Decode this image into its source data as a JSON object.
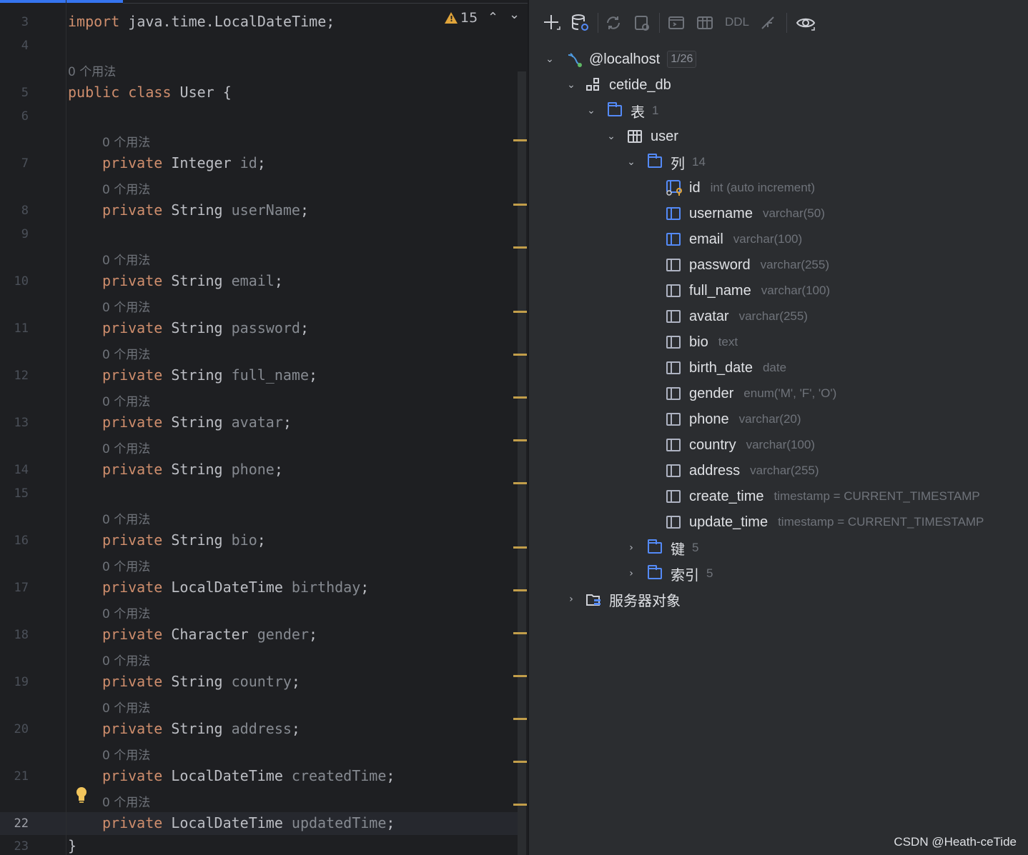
{
  "editor": {
    "warning_count": "15",
    "usage_hint": "0 个用法",
    "lines": [
      {
        "no": "3",
        "parts": [
          [
            "kw",
            "import"
          ],
          [
            "ty",
            " java.time.LocalDateTime;"
          ]
        ]
      },
      {
        "no": "4",
        "parts": []
      },
      {
        "no": "5",
        "parts": [
          [
            "kw",
            "public class"
          ],
          [
            "ty",
            " "
          ],
          [
            "cls",
            "User"
          ],
          [
            "ty",
            " {"
          ]
        ],
        "hint": "0 个用法"
      },
      {
        "no": "6",
        "parts": []
      },
      {
        "no": "7",
        "parts": [
          [
            "kw",
            "private"
          ],
          [
            "ty",
            " Integer "
          ],
          [
            "fld",
            "id"
          ],
          [
            "ty",
            ";"
          ]
        ],
        "hint": "0 个用法"
      },
      {
        "no": "8",
        "parts": [
          [
            "kw",
            "private"
          ],
          [
            "ty",
            " String "
          ],
          [
            "fld",
            "userName"
          ],
          [
            "ty",
            ";"
          ]
        ],
        "hint": "0 个用法"
      },
      {
        "no": "9",
        "parts": []
      },
      {
        "no": "10",
        "parts": [
          [
            "kw",
            "private"
          ],
          [
            "ty",
            " String "
          ],
          [
            "fld",
            "email"
          ],
          [
            "ty",
            ";"
          ]
        ],
        "hint": "0 个用法"
      },
      {
        "no": "11",
        "parts": [
          [
            "kw",
            "private"
          ],
          [
            "ty",
            " String "
          ],
          [
            "fld",
            "password"
          ],
          [
            "ty",
            ";"
          ]
        ],
        "hint": "0 个用法"
      },
      {
        "no": "12",
        "parts": [
          [
            "kw",
            "private"
          ],
          [
            "ty",
            " String "
          ],
          [
            "fld",
            "full_name"
          ],
          [
            "ty",
            ";"
          ]
        ],
        "hint": "0 个用法"
      },
      {
        "no": "13",
        "parts": [
          [
            "kw",
            "private"
          ],
          [
            "ty",
            " String "
          ],
          [
            "fld",
            "avatar"
          ],
          [
            "ty",
            ";"
          ]
        ],
        "hint": "0 个用法"
      },
      {
        "no": "14",
        "parts": [
          [
            "kw",
            "private"
          ],
          [
            "ty",
            " String "
          ],
          [
            "fld",
            "phone"
          ],
          [
            "ty",
            ";"
          ]
        ],
        "hint": "0 个用法"
      },
      {
        "no": "15",
        "parts": []
      },
      {
        "no": "16",
        "parts": [
          [
            "kw",
            "private"
          ],
          [
            "ty",
            " String "
          ],
          [
            "fld",
            "bio"
          ],
          [
            "ty",
            ";"
          ]
        ],
        "hint": "0 个用法"
      },
      {
        "no": "17",
        "parts": [
          [
            "kw",
            "private"
          ],
          [
            "ty",
            " LocalDateTime "
          ],
          [
            "fld",
            "birthday"
          ],
          [
            "ty",
            ";"
          ]
        ],
        "hint": "0 个用法"
      },
      {
        "no": "18",
        "parts": [
          [
            "kw",
            "private"
          ],
          [
            "ty",
            " Character "
          ],
          [
            "fld",
            "gender"
          ],
          [
            "ty",
            ";"
          ]
        ],
        "hint": "0 个用法"
      },
      {
        "no": "19",
        "parts": [
          [
            "kw",
            "private"
          ],
          [
            "ty",
            " String "
          ],
          [
            "fld",
            "country"
          ],
          [
            "ty",
            ";"
          ]
        ],
        "hint": "0 个用法"
      },
      {
        "no": "20",
        "parts": [
          [
            "kw",
            "private"
          ],
          [
            "ty",
            " String "
          ],
          [
            "fld",
            "address"
          ],
          [
            "ty",
            ";"
          ]
        ],
        "hint": "0 个用法"
      },
      {
        "no": "21",
        "parts": [
          [
            "kw",
            "private"
          ],
          [
            "ty",
            " LocalDateTime "
          ],
          [
            "fld",
            "createdTime"
          ],
          [
            "ty",
            ";"
          ]
        ],
        "hint": "0 个用法"
      },
      {
        "no": "22",
        "parts": [
          [
            "kw",
            "private"
          ],
          [
            "ty",
            " LocalDateTime "
          ],
          [
            "fld",
            "updatedTime"
          ],
          [
            "ty",
            ";"
          ]
        ],
        "hint": "0 个用法"
      },
      {
        "no": "23",
        "parts": [
          [
            "ty",
            "}"
          ]
        ]
      }
    ]
  },
  "db_toolbar": {
    "ddl_label": "DDL",
    "icons": [
      "add-icon",
      "datasource-properties-icon",
      "refresh-icon",
      "jump-to-query-console-icon",
      "query-console-icon",
      "table-view-icon",
      "compare-icon",
      "view-options-icon"
    ]
  },
  "tree": {
    "host": {
      "name": "@localhost",
      "badge": "1/26"
    },
    "schema": {
      "name": "cetide_db"
    },
    "tables_folder": {
      "name": "表",
      "count": "1"
    },
    "table": {
      "name": "user"
    },
    "columns_folder": {
      "name": "列",
      "count": "14"
    },
    "columns": [
      {
        "name": "id",
        "type": "int (auto increment)",
        "pk": true
      },
      {
        "name": "username",
        "type": "varchar(50)",
        "indexed": true
      },
      {
        "name": "email",
        "type": "varchar(100)",
        "indexed": true
      },
      {
        "name": "password",
        "type": "varchar(255)"
      },
      {
        "name": "full_name",
        "type": "varchar(100)"
      },
      {
        "name": "avatar",
        "type": "varchar(255)"
      },
      {
        "name": "bio",
        "type": "text"
      },
      {
        "name": "birth_date",
        "type": "date"
      },
      {
        "name": "gender",
        "type": "enum('M', 'F', 'O')"
      },
      {
        "name": "phone",
        "type": "varchar(20)"
      },
      {
        "name": "country",
        "type": "varchar(100)"
      },
      {
        "name": "address",
        "type": "varchar(255)"
      },
      {
        "name": "create_time",
        "type": "timestamp = CURRENT_TIMESTAMP"
      },
      {
        "name": "update_time",
        "type": "timestamp = CURRENT_TIMESTAMP"
      }
    ],
    "keys_folder": {
      "name": "键",
      "count": "5"
    },
    "indexes_folder": {
      "name": "索引",
      "count": "5"
    },
    "server_objects": {
      "name": "服务器对象"
    }
  },
  "watermark": "CSDN @Heath-ceTide",
  "colors": {
    "keyword": "#cf8e6d",
    "field": "#868a91",
    "accent": "#3574f0",
    "folder": "#548af7",
    "warning": "#e0a43a"
  }
}
